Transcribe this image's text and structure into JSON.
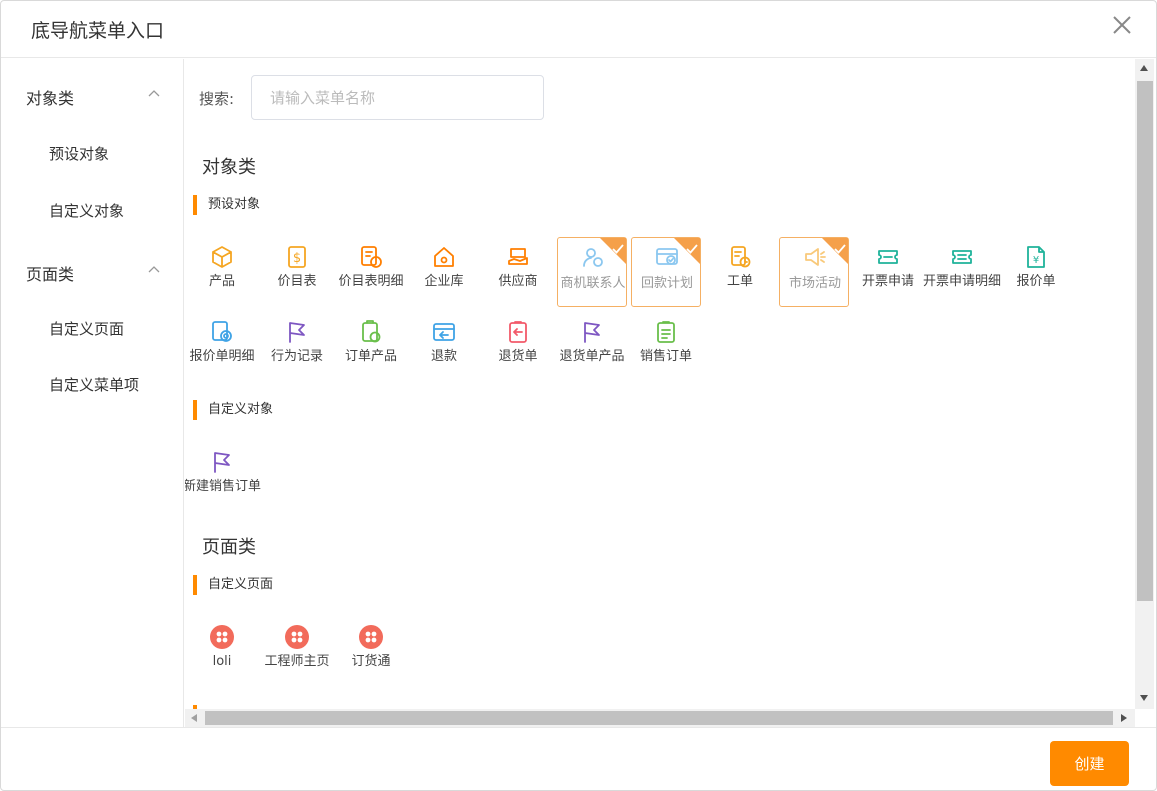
{
  "dialog": {
    "title": "底导航菜单入口"
  },
  "sidebar": {
    "categories": [
      {
        "label": "对象类",
        "items": [
          {
            "label": "预设对象"
          },
          {
            "label": "自定义对象"
          }
        ]
      },
      {
        "label": "页面类",
        "items": [
          {
            "label": "自定义页面"
          },
          {
            "label": "自定义菜单项"
          }
        ]
      }
    ]
  },
  "search": {
    "label": "搜索:",
    "placeholder": "请输入菜单名称",
    "value": ""
  },
  "groups": [
    {
      "title": "对象类",
      "sections": [
        {
          "title": "预设对象",
          "items": [
            {
              "label": "产品",
              "icon": "cube-icon",
              "color": "#f5a623",
              "selected": false
            },
            {
              "label": "价目表",
              "icon": "price-list-icon",
              "color": "#f5a623",
              "selected": false
            },
            {
              "label": "价目表明细",
              "icon": "price-detail-icon",
              "color": "#ff7f00",
              "selected": false
            },
            {
              "label": "企业库",
              "icon": "house-icon",
              "color": "#ff7f00",
              "selected": false
            },
            {
              "label": "供应商",
              "icon": "supplier-icon",
              "color": "#ff7f00",
              "selected": false
            },
            {
              "label": "商机联系人",
              "icon": "contact-icon",
              "color": "#3fa3e6",
              "selected": true
            },
            {
              "label": "回款计划",
              "icon": "payment-plan-icon",
              "color": "#3fa3e6",
              "selected": true
            },
            {
              "label": "工单",
              "icon": "work-order-icon",
              "color": "#f5a623",
              "selected": false
            },
            {
              "label": "市场活动",
              "icon": "megaphone-icon",
              "color": "#f5a623",
              "selected": true
            },
            {
              "label": "开票申请",
              "icon": "invoice-icon",
              "color": "#1fb39a",
              "selected": false
            },
            {
              "label": "开票申请明细",
              "icon": "invoice-detail-icon",
              "color": "#1fb39a",
              "selected": false
            },
            {
              "label": "报价单",
              "icon": "quote-icon",
              "color": "#1fb39a",
              "selected": false
            },
            {
              "label": "报价单明细",
              "icon": "quote-detail-icon",
              "color": "#3fa3e6",
              "selected": false
            },
            {
              "label": "行为记录",
              "icon": "flag-icon",
              "color": "#7e57c2",
              "selected": false
            },
            {
              "label": "订单产品",
              "icon": "order-product-icon",
              "color": "#6abf4b",
              "selected": false
            },
            {
              "label": "退款",
              "icon": "refund-icon",
              "color": "#3fa3e6",
              "selected": false
            },
            {
              "label": "退货单",
              "icon": "return-order-icon",
              "color": "#f25a6a",
              "selected": false
            },
            {
              "label": "退货单产品",
              "icon": "flag-icon",
              "color": "#7e57c2",
              "selected": false
            },
            {
              "label": "销售订单",
              "icon": "sales-order-icon",
              "color": "#6abf4b",
              "selected": false
            }
          ]
        },
        {
          "title": "自定义对象",
          "items": [
            {
              "label": "新建销售订单",
              "icon": "flag-icon",
              "color": "#7e57c2",
              "selected": false
            }
          ]
        }
      ]
    },
    {
      "title": "页面类",
      "sections": [
        {
          "title": "自定义页面",
          "items": [
            {
              "label": "loli",
              "icon": "grid-circle-icon",
              "color": "#f26b5b",
              "selected": false
            },
            {
              "label": "工程师主页",
              "icon": "grid-circle-icon",
              "color": "#f26b5b",
              "selected": false
            },
            {
              "label": "订货通",
              "icon": "grid-circle-icon",
              "color": "#f26b5b",
              "selected": false
            }
          ]
        }
      ]
    }
  ],
  "footer": {
    "create_label": "创建"
  },
  "colors": {
    "accent": "#ff8a00",
    "selected_border": "#f5b064"
  }
}
